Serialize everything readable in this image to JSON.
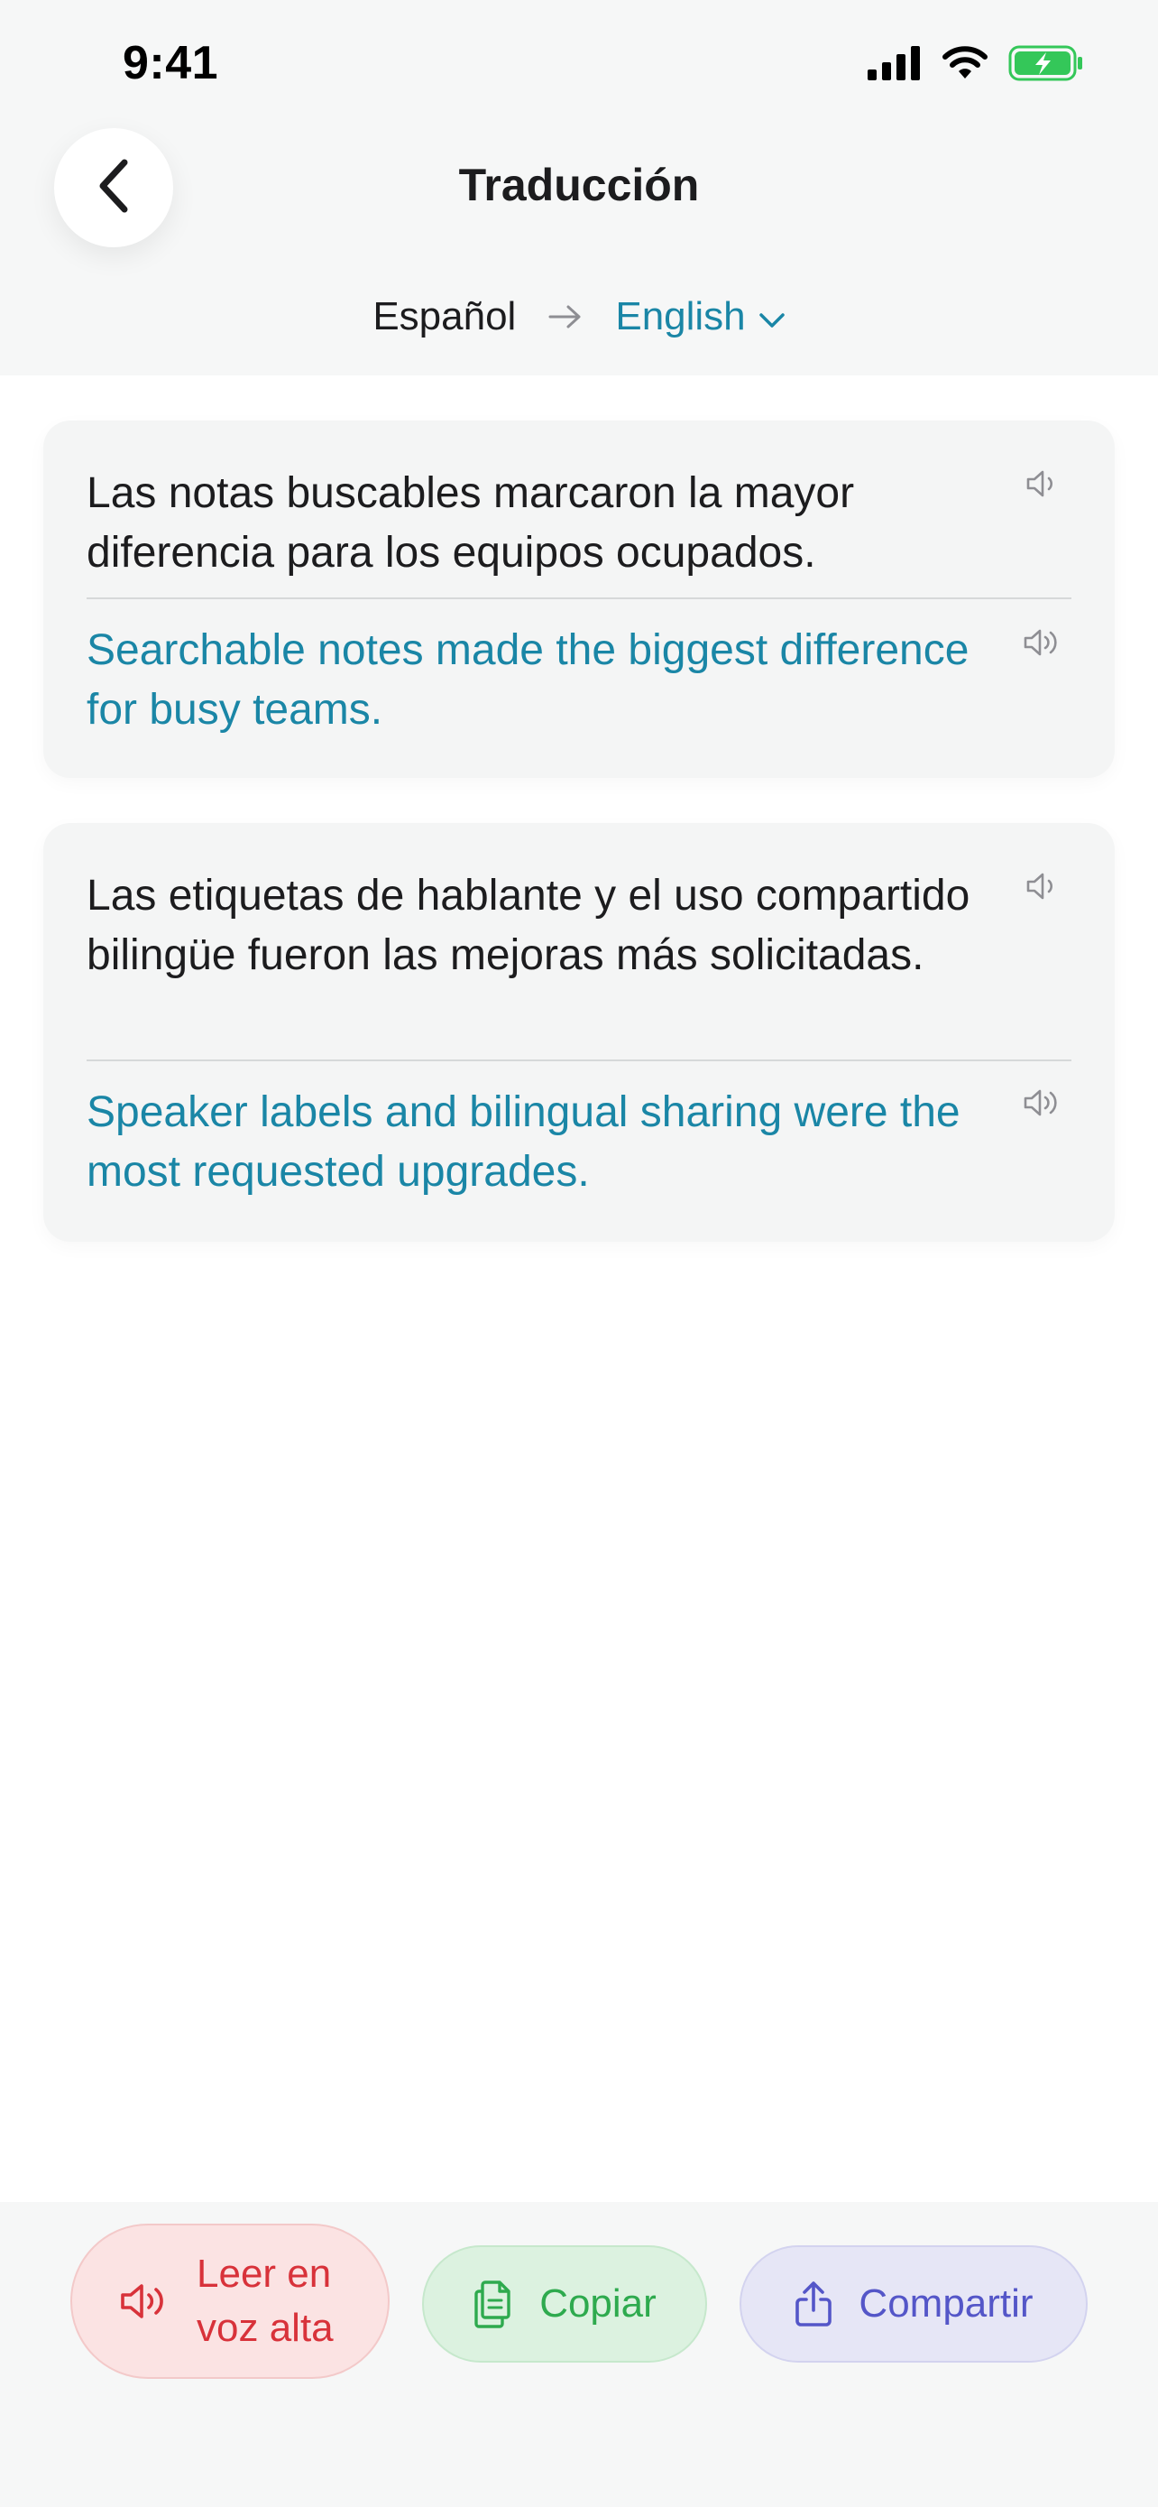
{
  "status_bar": {
    "time": "9:41"
  },
  "header": {
    "title": "Traducción",
    "source_language": "Español",
    "target_language": "English"
  },
  "segments": [
    {
      "original": "Las notas buscables marcaron la mayor diferencia para los equipos ocupados.",
      "translation": "Searchable notes made the biggest difference for busy teams."
    },
    {
      "original": "Las etiquetas de hablante y el uso compartido bilingüe fueron las mejoras más solicitadas.",
      "translation": "Speaker labels and bilingual sharing were the most requested upgrades."
    }
  ],
  "actions": {
    "read_aloud": "Leer en voz alta",
    "copy": "Copiar",
    "share": "Compartir"
  },
  "colors": {
    "accent": "#1a86a6",
    "read_aloud": "#d8323a",
    "copy": "#2eaa4e",
    "share": "#5456c8",
    "battery": "#34c759"
  }
}
